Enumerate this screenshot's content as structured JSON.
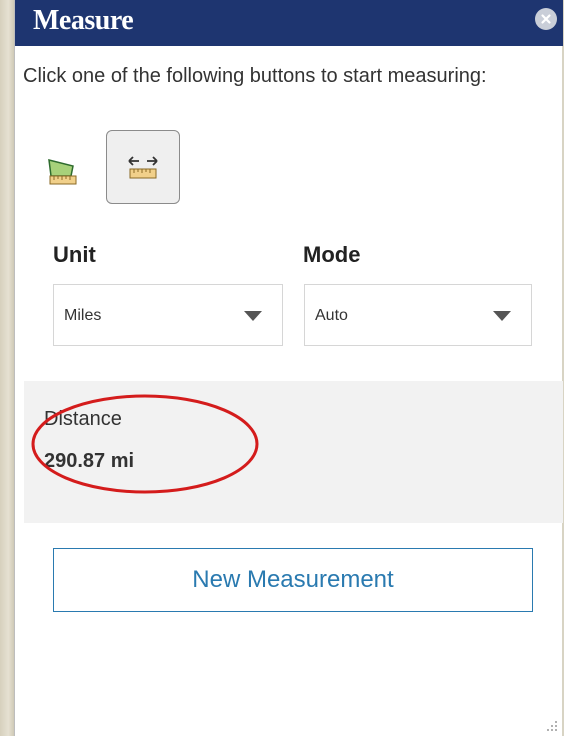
{
  "panel": {
    "title": "Measure",
    "close_icon": "close-icon",
    "instructions": "Click one of the following buttons to start measuring:"
  },
  "tools": [
    {
      "name": "area",
      "icon": "area-ruler-icon",
      "selected": false
    },
    {
      "name": "distance",
      "icon": "distance-ruler-icon",
      "selected": true
    }
  ],
  "unit": {
    "label": "Unit",
    "selected": "Miles"
  },
  "mode": {
    "label": "Mode",
    "selected": "Auto"
  },
  "result": {
    "label": "Distance",
    "value": "290.87 mi"
  },
  "actions": {
    "new_measurement": "New Measurement"
  },
  "colors": {
    "header_bg": "#1e3570",
    "accent_blue": "#2a7ab0",
    "highlight_red": "#d41c1c",
    "result_bg": "#f2f2f2"
  }
}
